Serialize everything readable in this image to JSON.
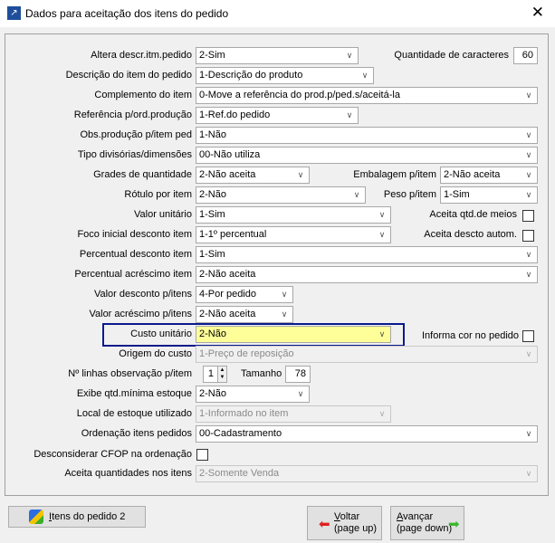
{
  "window": {
    "title": "Dados para aceitação dos itens do pedido"
  },
  "fields": {
    "altera_descr": {
      "label": "Altera descr.itm.pedido",
      "value": "2-Sim"
    },
    "qtd_caracteres": {
      "label": "Quantidade de caracteres",
      "value": "60"
    },
    "descricao_item": {
      "label": "Descrição do item do pedido",
      "value": "1-Descrição do produto"
    },
    "complemento": {
      "label": "Complemento do item",
      "value": "0-Move a referência do prod.p/ped.s/aceitá-la"
    },
    "referencia": {
      "label": "Referência p/ord.produção",
      "value": "1-Ref.do pedido"
    },
    "obs_producao": {
      "label": "Obs.produção p/item ped",
      "value": "1-Não"
    },
    "tipo_divisorias": {
      "label": "Tipo divisórias/dimensões",
      "value": "00-Não utiliza"
    },
    "grades": {
      "label": "Grades de quantidade",
      "value": "2-Não aceita"
    },
    "embalagem": {
      "label": "Embalagem p/item",
      "value": "2-Não aceita"
    },
    "rotulo": {
      "label": "Rótulo por item",
      "value": "2-Não"
    },
    "peso": {
      "label": "Peso p/item",
      "value": "1-Sim"
    },
    "valor_unitario": {
      "label": "Valor unitário",
      "value": "1-Sim"
    },
    "aceita_meios": {
      "label": "Aceita qtd.de meios",
      "checked": false
    },
    "foco_desconto": {
      "label": "Foco inicial desconto item",
      "value": "1-1º percentual"
    },
    "aceita_descto": {
      "label": "Aceita descto autom.",
      "checked": false
    },
    "perc_desconto": {
      "label": "Percentual desconto item",
      "value": "1-Sim"
    },
    "perc_acrescimo": {
      "label": "Percentual acréscimo item",
      "value": "2-Não aceita"
    },
    "valor_desconto": {
      "label": "Valor desconto p/itens",
      "value": "4-Por pedido"
    },
    "valor_acrescimo": {
      "label": "Valor acréscimo p/itens",
      "value": "2-Não aceita"
    },
    "custo_unitario": {
      "label": "Custo unitário",
      "value": "2-Não"
    },
    "informa_cor": {
      "label": "Informa cor no pedido",
      "checked": false
    },
    "origem_custo": {
      "label": "Origem do custo",
      "value": "1-Preço de reposição"
    },
    "linhas_obs": {
      "label": "Nº linhas observação p/item",
      "value": "1"
    },
    "tamanho": {
      "label": "Tamanho",
      "value": "78"
    },
    "exibe_qtd": {
      "label": "Exibe qtd.mínima estoque",
      "value": "2-Não"
    },
    "local_estoque": {
      "label": "Local de estoque utilizado",
      "value": "1-Informado no item"
    },
    "ordenacao": {
      "label": "Ordenação itens pedidos",
      "value": "00-Cadastramento"
    },
    "desconsiderar_cfop": {
      "label": "Desconsiderar CFOP na ordenação",
      "checked": false
    },
    "aceita_qtds": {
      "label": "Aceita quantidades nos itens",
      "value": "2-Somente Venda"
    }
  },
  "buttons": {
    "itens": {
      "accel": "I",
      "label": "tens do pedido 2"
    },
    "voltar": {
      "accel": "V",
      "label": "oltar",
      "sub": "(page up)"
    },
    "avancar": {
      "accel": "A",
      "label": "vançar",
      "sub": "(page down)"
    }
  }
}
